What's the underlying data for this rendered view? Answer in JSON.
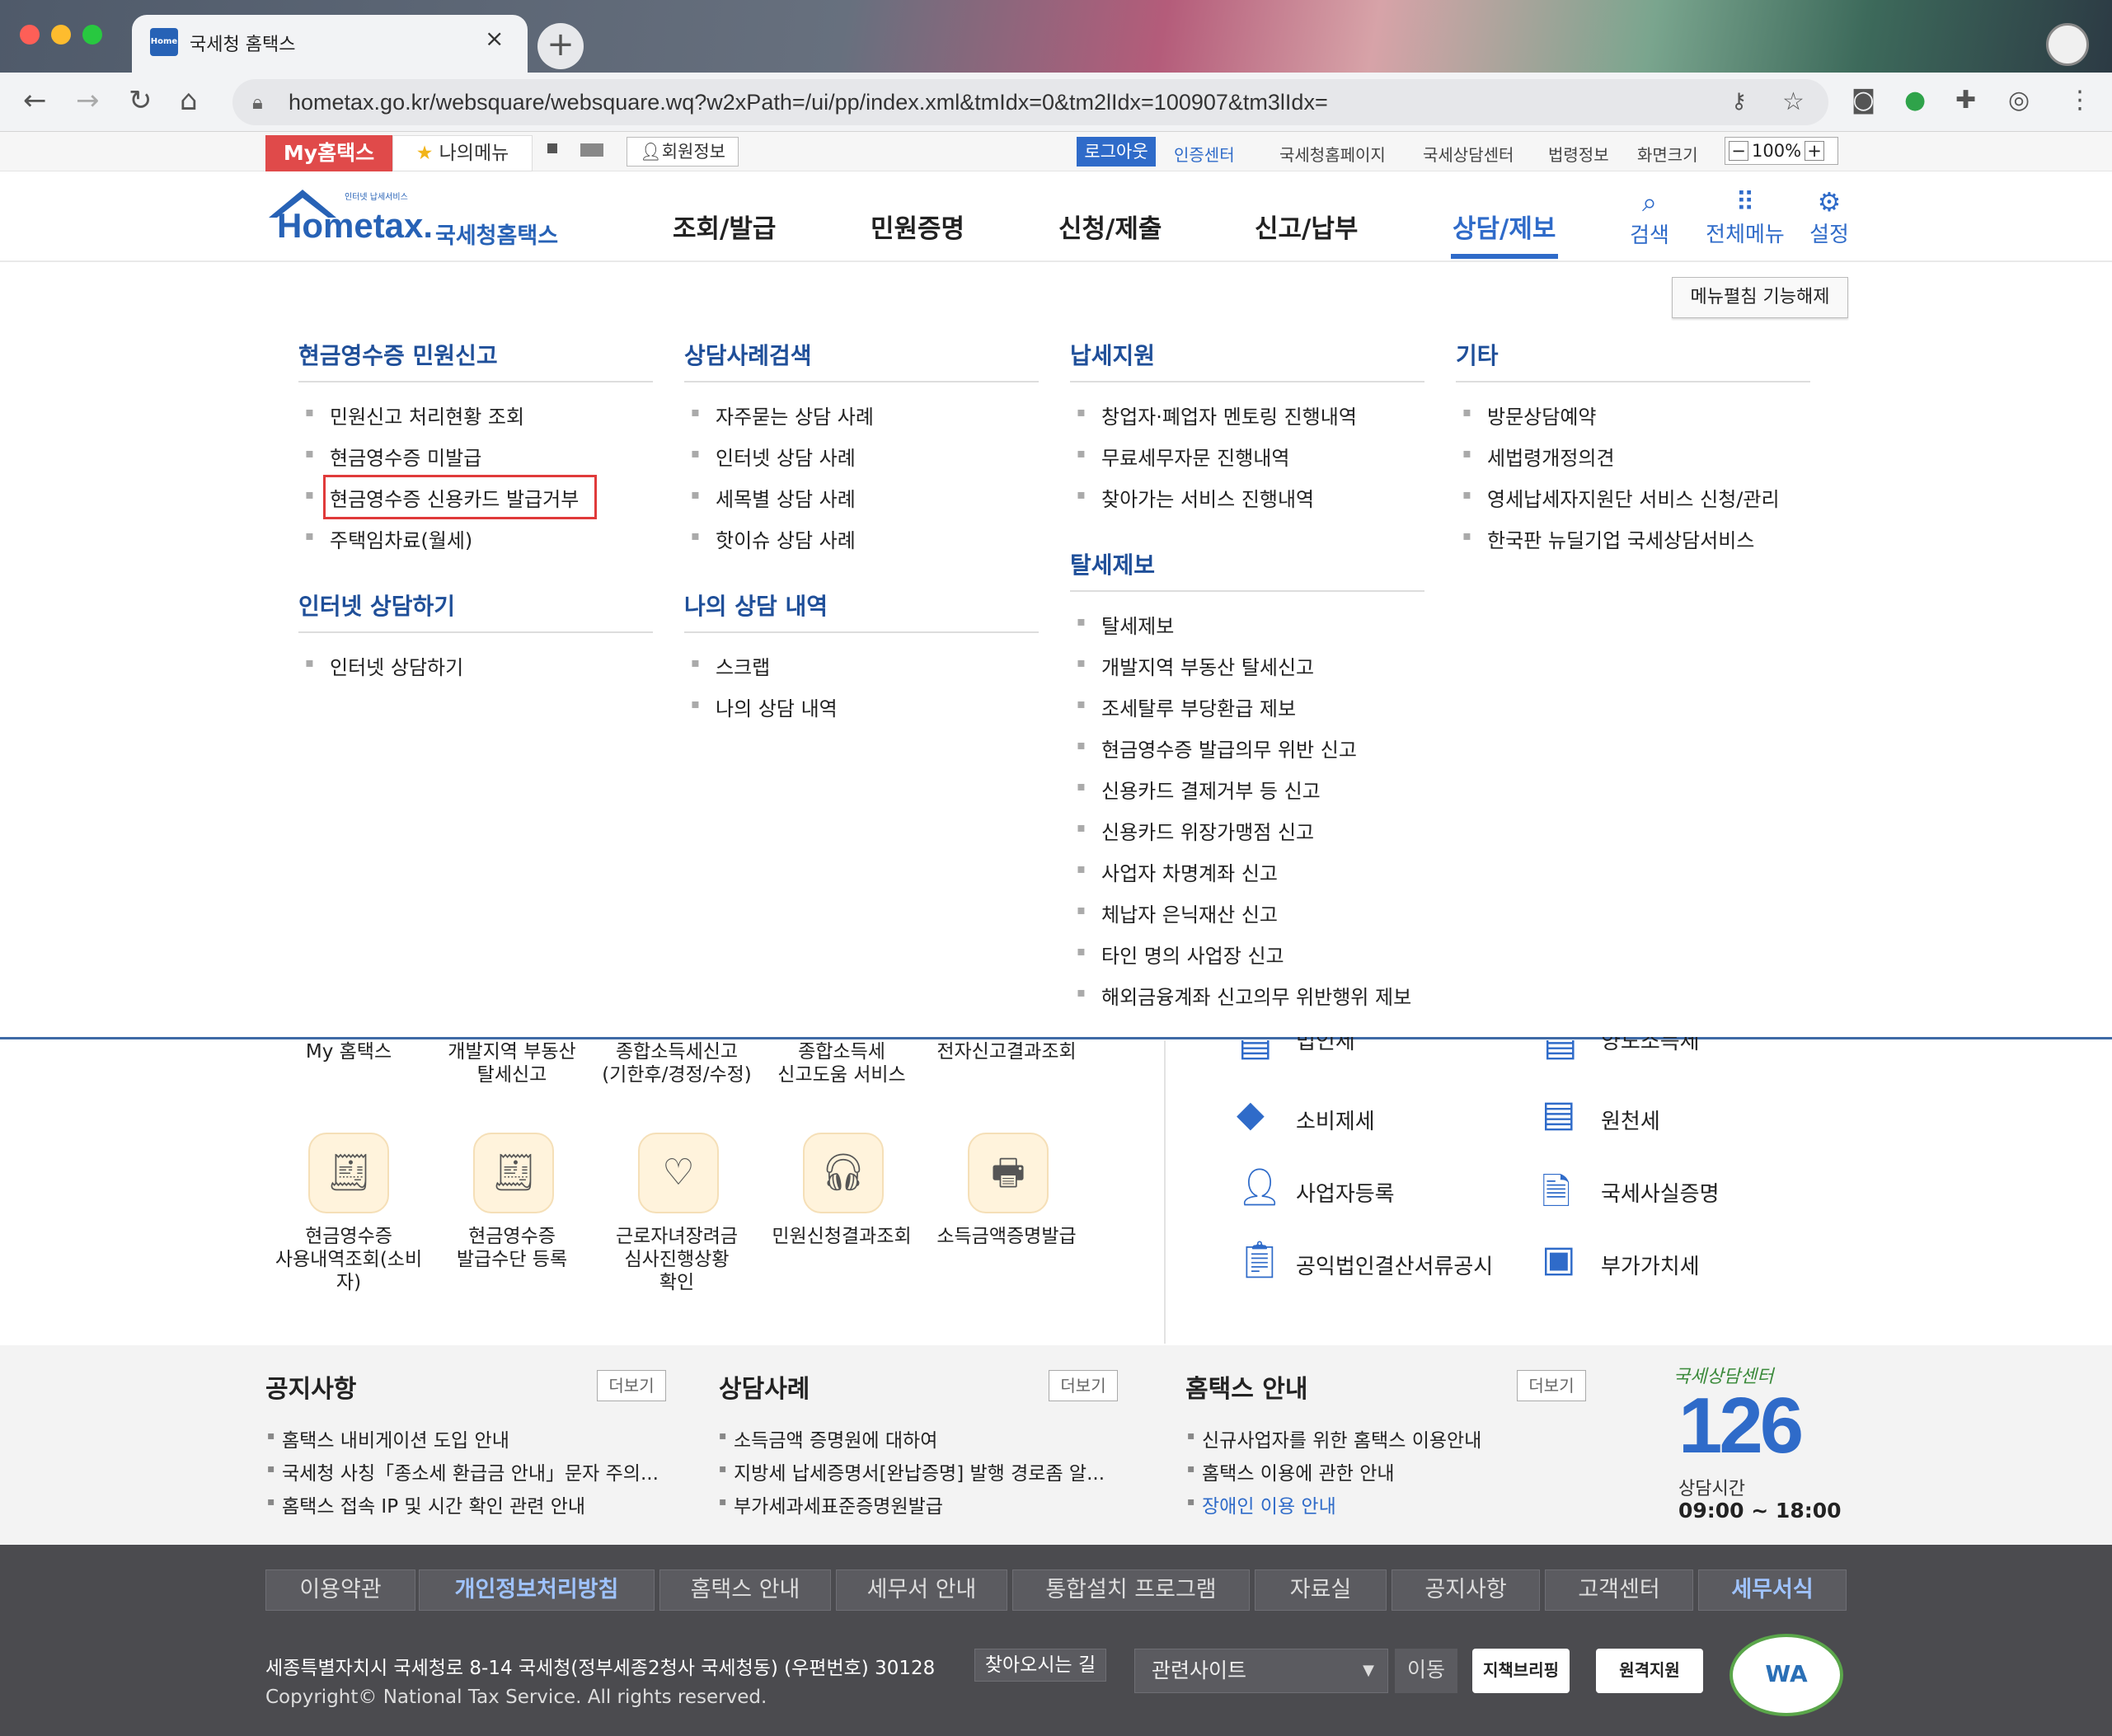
{
  "browser": {
    "tab_title": "국세청 홈택스",
    "tab_favicon_text": "Home",
    "tab_close": "×",
    "new_tab": "+",
    "url": "hometax.go.kr/websquare/websquare.wq?w2xPath=/ui/pp/index.xml&tmIdx=0&tm2lIdx=100907&tm3lIdx="
  },
  "colors": {
    "accent": "#2f6bc9",
    "highlight": "#e03a3a",
    "footer_bg": "#4b4b4f"
  },
  "utility": {
    "my_hometax": "My홈택스",
    "my_menu": "나의메뉴",
    "member_info": "회원정보",
    "logout": "로그아웃",
    "cert_center": "인증센터",
    "links": [
      "국세청홈페이지",
      "국세상담센터",
      "법령정보",
      "화면크기"
    ],
    "zoom": "100%"
  },
  "header": {
    "logo_small": "인터넷 납세서비스",
    "logo_main": "Hometax.",
    "logo_kor": "국세청홈택스",
    "nav": [
      "조회/발급",
      "민원증명",
      "신청/제출",
      "신고/납부",
      "상담/제보"
    ],
    "icons": {
      "search": "검색",
      "allmenu": "전체메뉴",
      "settings": "설정"
    }
  },
  "mega": {
    "unfold_button": "메뉴펼침 기능해제",
    "col1": {
      "title": "현금영수증 민원신고",
      "items": [
        "민원신고 처리현황 조회",
        "현금영수증 미발급",
        "현금영수증 신용카드 발급거부",
        "주택임차료(월세)"
      ],
      "title2": "인터넷 상담하기",
      "items2": [
        "인터넷 상담하기"
      ]
    },
    "col2": {
      "title": "상담사례검색",
      "items": [
        "자주묻는 상담 사례",
        "인터넷 상담 사례",
        "세목별 상담 사례",
        "핫이슈 상담 사례"
      ],
      "title2": "나의 상담 내역",
      "items2": [
        "스크랩",
        "나의 상담 내역"
      ]
    },
    "col3": {
      "title": "납세지원",
      "items": [
        "창업자·폐업자 멘토링 진행내역",
        "무료세무자문 진행내역",
        "찾아가는 서비스 진행내역"
      ],
      "title2": "탈세제보",
      "items2": [
        "탈세제보",
        "개발지역 부동산 탈세신고",
        "조세탈루 부당환급 제보",
        "현금영수증 발급의무 위반 신고",
        "신용카드 결제거부 등 신고",
        "신용카드 위장가맹점 신고",
        "사업자 차명계좌 신고",
        "체납자 은닉재산 신고",
        "타인 명의 사업장 신고",
        "해외금융계좌 신고의무 위반행위 제보"
      ]
    },
    "col4": {
      "title": "기타",
      "items": [
        "방문상담예약",
        "세법령개정의견",
        "영세납세자지원단 서비스 신청/관리",
        "한국판 뉴딜기업 국세상담서비스"
      ]
    }
  },
  "services_top": [
    {
      "label": "My 홈택스"
    },
    {
      "label": "개발지역 부동산\n탈세신고"
    },
    {
      "label": "종합소득세신고\n(기한후/경정/수정)"
    },
    {
      "label": "종합소득세\n신고도움 서비스"
    },
    {
      "label": "전자신고결과조회"
    }
  ],
  "services": [
    {
      "label": "현금영수증\n사용내역조회(소비\n자)",
      "icon": "receipt-search-icon"
    },
    {
      "label": "현금영수증\n발급수단 등록",
      "icon": "receipt-register-icon"
    },
    {
      "label": "근로자녀장려금\n심사진행상황\n확인",
      "icon": "heart-hand-icon"
    },
    {
      "label": "민원신청결과조회",
      "icon": "headset-icon"
    },
    {
      "label": "소득금액증명발급",
      "icon": "printer-icon"
    }
  ],
  "taxes_top": [
    "법인세",
    "양도소득세"
  ],
  "taxes": [
    {
      "label": "소비제세",
      "icon": "diamond-icon"
    },
    {
      "label": "원천세",
      "icon": "withholding-doc-icon"
    },
    {
      "label": "사업자등록",
      "icon": "person-icon"
    },
    {
      "label": "국세사실증명",
      "icon": "document-icon"
    },
    {
      "label": "공익법인결산서류공시",
      "icon": "clipboard-icon"
    },
    {
      "label": "부가가치세",
      "icon": "vat-icon"
    }
  ],
  "notices": {
    "more": "더보기",
    "notice": {
      "title": "공지사항",
      "items": [
        "홈택스 내비게이션 도입 안내",
        "국세청 사칭「종소세 환급금 안내」문자 주의...",
        "홈택스 접속 IP 및 시간 확인 관련 안내"
      ]
    },
    "cases": {
      "title": "상담사례",
      "items": [
        "소득금액 증명원에 대하여",
        "지방세 납세증명서[완납증명] 발행 경로좀 알...",
        "부가세과세표준증명원발급"
      ]
    },
    "guide": {
      "title": "홈택스 안내",
      "items": [
        "신규사업자를 위한 홈택스 이용안내",
        "홈택스 이용에 관한 안내",
        "장애인 이용 안내"
      ]
    },
    "center": {
      "label": "국세상담센터",
      "number": "126",
      "hours_label": "상담시간",
      "hours": "09:00 ~ 18:00"
    }
  },
  "footer": {
    "links": [
      "이용약관",
      "개인정보처리방침",
      "홈택스 안내",
      "세무서 안내",
      "통합설치 프로그램",
      "자료실",
      "공지사항",
      "고객센터",
      "세무서식"
    ],
    "address": "세종특별자치시 국세청로 8-14 국세청(정부세종2청사 국세청동) (우편번호) 30128",
    "find_way": "찾아오시는 길",
    "copyright": "Copyright© National Tax Service. All rights reserved.",
    "related": "관련사이트",
    "move": "이동",
    "badge1": "지책브리핑",
    "badge2": "원격지원",
    "wa": "WA"
  }
}
